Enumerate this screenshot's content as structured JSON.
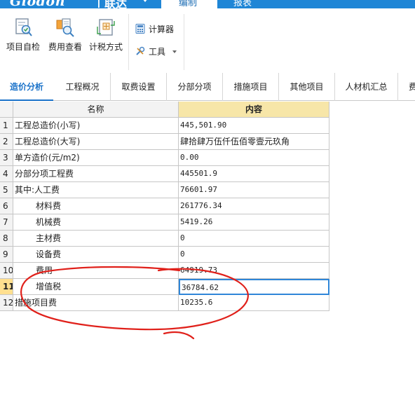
{
  "brand": {
    "logo_text": "Glodon",
    "separator": "|",
    "product_name": "联达",
    "primary_color": "#1f86d6"
  },
  "top_menu": {
    "edit_label": "编制",
    "report_label": "报表"
  },
  "ribbon": {
    "self_check_label": "项目自检",
    "fee_view_label": "费用查看",
    "tax_method_label": "计税方式",
    "calculator_label": "计算器",
    "tools_label": "工具"
  },
  "tabs": [
    {
      "label": "造价分析",
      "active": true
    },
    {
      "label": "工程概况"
    },
    {
      "label": "取费设置"
    },
    {
      "label": "分部分项"
    },
    {
      "label": "措施项目"
    },
    {
      "label": "其他项目"
    },
    {
      "label": "人材机汇总"
    },
    {
      "label": "费"
    }
  ],
  "grid": {
    "columns": [
      "名称",
      "内容"
    ],
    "rows": [
      {
        "num": "1",
        "name": "工程总造价(小写)",
        "value": "445,501.90"
      },
      {
        "num": "2",
        "name": "工程总造价(大写)",
        "value": "肆拾肆万伍仟伍佰零壹元玖角"
      },
      {
        "num": "3",
        "name": "单方造价(元/m2)",
        "value": "0.00"
      },
      {
        "num": "4",
        "name": "分部分项工程费",
        "value": "445501.9"
      },
      {
        "num": "5",
        "name": "其中:人工费",
        "value": "76601.97"
      },
      {
        "num": "6",
        "name": "材料费",
        "value": "261776.34"
      },
      {
        "num": "7",
        "name": "机械费",
        "value": "5419.26"
      },
      {
        "num": "8",
        "name": "主材费",
        "value": "0"
      },
      {
        "num": "9",
        "name": "设备费",
        "value": "0"
      },
      {
        "num": "10",
        "name": "费用",
        "value": "64919.73"
      },
      {
        "num": "11",
        "name": "增值税",
        "value": "36784.62"
      },
      {
        "num": "12",
        "name": "措施项目费",
        "value": "10235.6"
      }
    ],
    "selected_row": "11",
    "header_highlight_color": "#f7e6a8",
    "selection_color": "#2f86d8"
  },
  "annotation": {
    "color": "#e0201a"
  }
}
